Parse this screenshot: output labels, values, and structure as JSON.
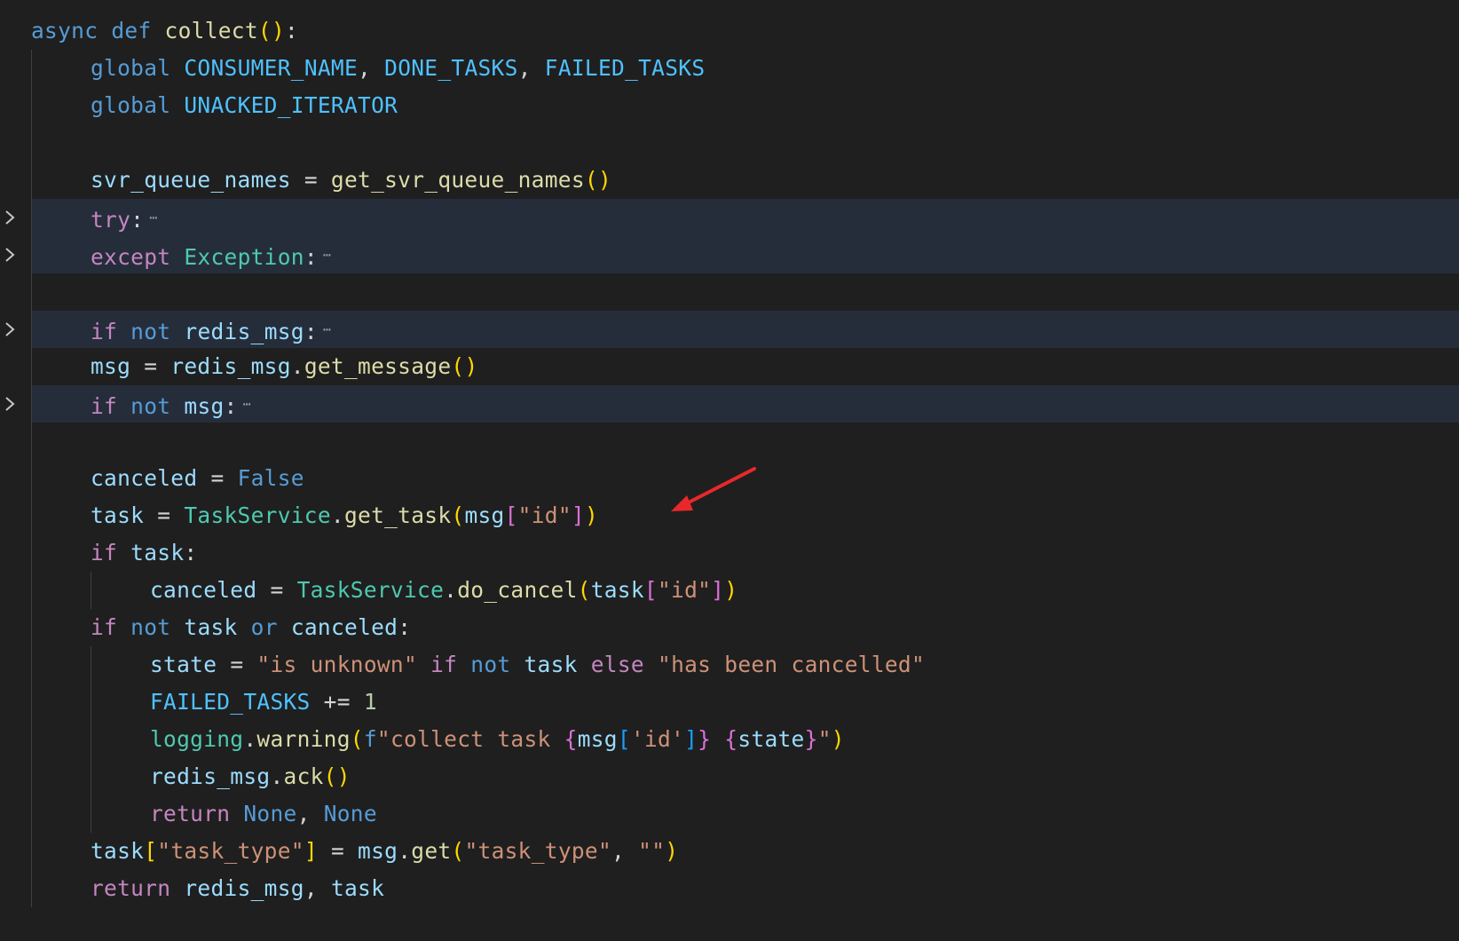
{
  "editor": {
    "language": "python",
    "fold_ellipsis": "⋯",
    "lines": [
      {
        "indent": 0,
        "folded": false,
        "tokens": [
          {
            "t": "async",
            "c": "kw"
          },
          {
            "t": " "
          },
          {
            "t": "def",
            "c": "kw"
          },
          {
            "t": " "
          },
          {
            "t": "collect",
            "c": "fn"
          },
          {
            "t": "()",
            "c": "br1"
          },
          {
            "t": ":"
          }
        ]
      },
      {
        "indent": 1,
        "folded": false,
        "tokens": [
          {
            "t": "global",
            "c": "kw"
          },
          {
            "t": " "
          },
          {
            "t": "CONSUMER_NAME",
            "c": "const"
          },
          {
            "t": ", "
          },
          {
            "t": "DONE_TASKS",
            "c": "const"
          },
          {
            "t": ", "
          },
          {
            "t": "FAILED_TASKS",
            "c": "const"
          }
        ]
      },
      {
        "indent": 1,
        "folded": false,
        "tokens": [
          {
            "t": "global",
            "c": "kw"
          },
          {
            "t": " "
          },
          {
            "t": "UNACKED_ITERATOR",
            "c": "const"
          }
        ]
      },
      {
        "indent": 1,
        "folded": false,
        "tokens": []
      },
      {
        "indent": 1,
        "folded": false,
        "tokens": [
          {
            "t": "svr_queue_names",
            "c": "var"
          },
          {
            "t": " = "
          },
          {
            "t": "get_svr_queue_names",
            "c": "fn"
          },
          {
            "t": "()",
            "c": "br1"
          }
        ]
      },
      {
        "indent": 1,
        "folded": true,
        "tokens": [
          {
            "t": "try",
            "c": "ctl"
          },
          {
            "t": ":"
          }
        ]
      },
      {
        "indent": 1,
        "folded": true,
        "tokens": [
          {
            "t": "except",
            "c": "ctl"
          },
          {
            "t": " "
          },
          {
            "t": "Exception",
            "c": "cls"
          },
          {
            "t": ":"
          }
        ]
      },
      {
        "indent": 1,
        "folded": false,
        "tokens": []
      },
      {
        "indent": 1,
        "folded": true,
        "tokens": [
          {
            "t": "if",
            "c": "ctl"
          },
          {
            "t": " "
          },
          {
            "t": "not",
            "c": "kw"
          },
          {
            "t": " "
          },
          {
            "t": "redis_msg",
            "c": "var"
          },
          {
            "t": ":"
          }
        ]
      },
      {
        "indent": 1,
        "folded": false,
        "tokens": [
          {
            "t": "msg",
            "c": "var"
          },
          {
            "t": " = "
          },
          {
            "t": "redis_msg",
            "c": "var"
          },
          {
            "t": "."
          },
          {
            "t": "get_message",
            "c": "fn"
          },
          {
            "t": "()",
            "c": "br1"
          }
        ]
      },
      {
        "indent": 1,
        "folded": true,
        "tokens": [
          {
            "t": "if",
            "c": "ctl"
          },
          {
            "t": " "
          },
          {
            "t": "not",
            "c": "kw"
          },
          {
            "t": " "
          },
          {
            "t": "msg",
            "c": "var"
          },
          {
            "t": ":"
          }
        ]
      },
      {
        "indent": 1,
        "folded": false,
        "tokens": []
      },
      {
        "indent": 1,
        "folded": false,
        "tokens": [
          {
            "t": "canceled",
            "c": "var"
          },
          {
            "t": " = "
          },
          {
            "t": "False",
            "c": "kw"
          }
        ]
      },
      {
        "indent": 1,
        "folded": false,
        "tokens": [
          {
            "t": "task",
            "c": "var"
          },
          {
            "t": " = "
          },
          {
            "t": "TaskService",
            "c": "cls"
          },
          {
            "t": "."
          },
          {
            "t": "get_task",
            "c": "fn"
          },
          {
            "t": "(",
            "c": "br1"
          },
          {
            "t": "msg",
            "c": "var"
          },
          {
            "t": "[",
            "c": "br2"
          },
          {
            "t": "\"id\"",
            "c": "str"
          },
          {
            "t": "]",
            "c": "br2"
          },
          {
            "t": ")",
            "c": "br1"
          }
        ]
      },
      {
        "indent": 1,
        "folded": false,
        "tokens": [
          {
            "t": "if",
            "c": "ctl"
          },
          {
            "t": " "
          },
          {
            "t": "task",
            "c": "var"
          },
          {
            "t": ":"
          }
        ]
      },
      {
        "indent": 2,
        "folded": false,
        "tokens": [
          {
            "t": "canceled",
            "c": "var"
          },
          {
            "t": " = "
          },
          {
            "t": "TaskService",
            "c": "cls"
          },
          {
            "t": "."
          },
          {
            "t": "do_cancel",
            "c": "fn"
          },
          {
            "t": "(",
            "c": "br1"
          },
          {
            "t": "task",
            "c": "var"
          },
          {
            "t": "[",
            "c": "br2"
          },
          {
            "t": "\"id\"",
            "c": "str"
          },
          {
            "t": "]",
            "c": "br2"
          },
          {
            "t": ")",
            "c": "br1"
          }
        ]
      },
      {
        "indent": 1,
        "folded": false,
        "tokens": [
          {
            "t": "if",
            "c": "ctl"
          },
          {
            "t": " "
          },
          {
            "t": "not",
            "c": "kw"
          },
          {
            "t": " "
          },
          {
            "t": "task",
            "c": "var"
          },
          {
            "t": " "
          },
          {
            "t": "or",
            "c": "kw"
          },
          {
            "t": " "
          },
          {
            "t": "canceled",
            "c": "var"
          },
          {
            "t": ":"
          }
        ]
      },
      {
        "indent": 2,
        "folded": false,
        "tokens": [
          {
            "t": "state",
            "c": "var"
          },
          {
            "t": " = "
          },
          {
            "t": "\"is unknown\"",
            "c": "str"
          },
          {
            "t": " "
          },
          {
            "t": "if",
            "c": "ctl"
          },
          {
            "t": " "
          },
          {
            "t": "not",
            "c": "kw"
          },
          {
            "t": " "
          },
          {
            "t": "task",
            "c": "var"
          },
          {
            "t": " "
          },
          {
            "t": "else",
            "c": "ctl"
          },
          {
            "t": " "
          },
          {
            "t": "\"has been cancelled\"",
            "c": "str"
          }
        ]
      },
      {
        "indent": 2,
        "folded": false,
        "tokens": [
          {
            "t": "FAILED_TASKS",
            "c": "const"
          },
          {
            "t": " += "
          },
          {
            "t": "1",
            "c": "num"
          }
        ]
      },
      {
        "indent": 2,
        "folded": false,
        "tokens": [
          {
            "t": "logging",
            "c": "cls"
          },
          {
            "t": "."
          },
          {
            "t": "warning",
            "c": "fn"
          },
          {
            "t": "(",
            "c": "br1"
          },
          {
            "t": "f",
            "c": "kw"
          },
          {
            "t": "\"collect task ",
            "c": "str"
          },
          {
            "t": "{",
            "c": "br2"
          },
          {
            "t": "msg",
            "c": "var"
          },
          {
            "t": "[",
            "c": "br3"
          },
          {
            "t": "'id'",
            "c": "str"
          },
          {
            "t": "]",
            "c": "br3"
          },
          {
            "t": "}",
            "c": "br2"
          },
          {
            "t": " ",
            "c": "str"
          },
          {
            "t": "{",
            "c": "br2"
          },
          {
            "t": "state",
            "c": "var"
          },
          {
            "t": "}",
            "c": "br2"
          },
          {
            "t": "\"",
            "c": "str"
          },
          {
            "t": ")",
            "c": "br1"
          }
        ]
      },
      {
        "indent": 2,
        "folded": false,
        "tokens": [
          {
            "t": "redis_msg",
            "c": "var"
          },
          {
            "t": "."
          },
          {
            "t": "ack",
            "c": "fn"
          },
          {
            "t": "()",
            "c": "br1"
          }
        ]
      },
      {
        "indent": 2,
        "folded": false,
        "tokens": [
          {
            "t": "return",
            "c": "ctl"
          },
          {
            "t": " "
          },
          {
            "t": "None",
            "c": "kw"
          },
          {
            "t": ", "
          },
          {
            "t": "None",
            "c": "kw"
          }
        ]
      },
      {
        "indent": 1,
        "folded": false,
        "tokens": [
          {
            "t": "task",
            "c": "var"
          },
          {
            "t": "[",
            "c": "br1"
          },
          {
            "t": "\"task_type\"",
            "c": "str"
          },
          {
            "t": "]",
            "c": "br1"
          },
          {
            "t": " = "
          },
          {
            "t": "msg",
            "c": "var"
          },
          {
            "t": "."
          },
          {
            "t": "get",
            "c": "fn"
          },
          {
            "t": "(",
            "c": "br1"
          },
          {
            "t": "\"task_type\"",
            "c": "str"
          },
          {
            "t": ", "
          },
          {
            "t": "\"\"",
            "c": "str"
          },
          {
            "t": ")",
            "c": "br1"
          }
        ]
      },
      {
        "indent": 1,
        "folded": false,
        "tokens": [
          {
            "t": "return",
            "c": "ctl"
          },
          {
            "t": " "
          },
          {
            "t": "redis_msg",
            "c": "var"
          },
          {
            "t": ", "
          },
          {
            "t": "task",
            "c": "var"
          }
        ]
      }
    ]
  },
  "annotation": {
    "arrow_color": "#e8282b"
  }
}
